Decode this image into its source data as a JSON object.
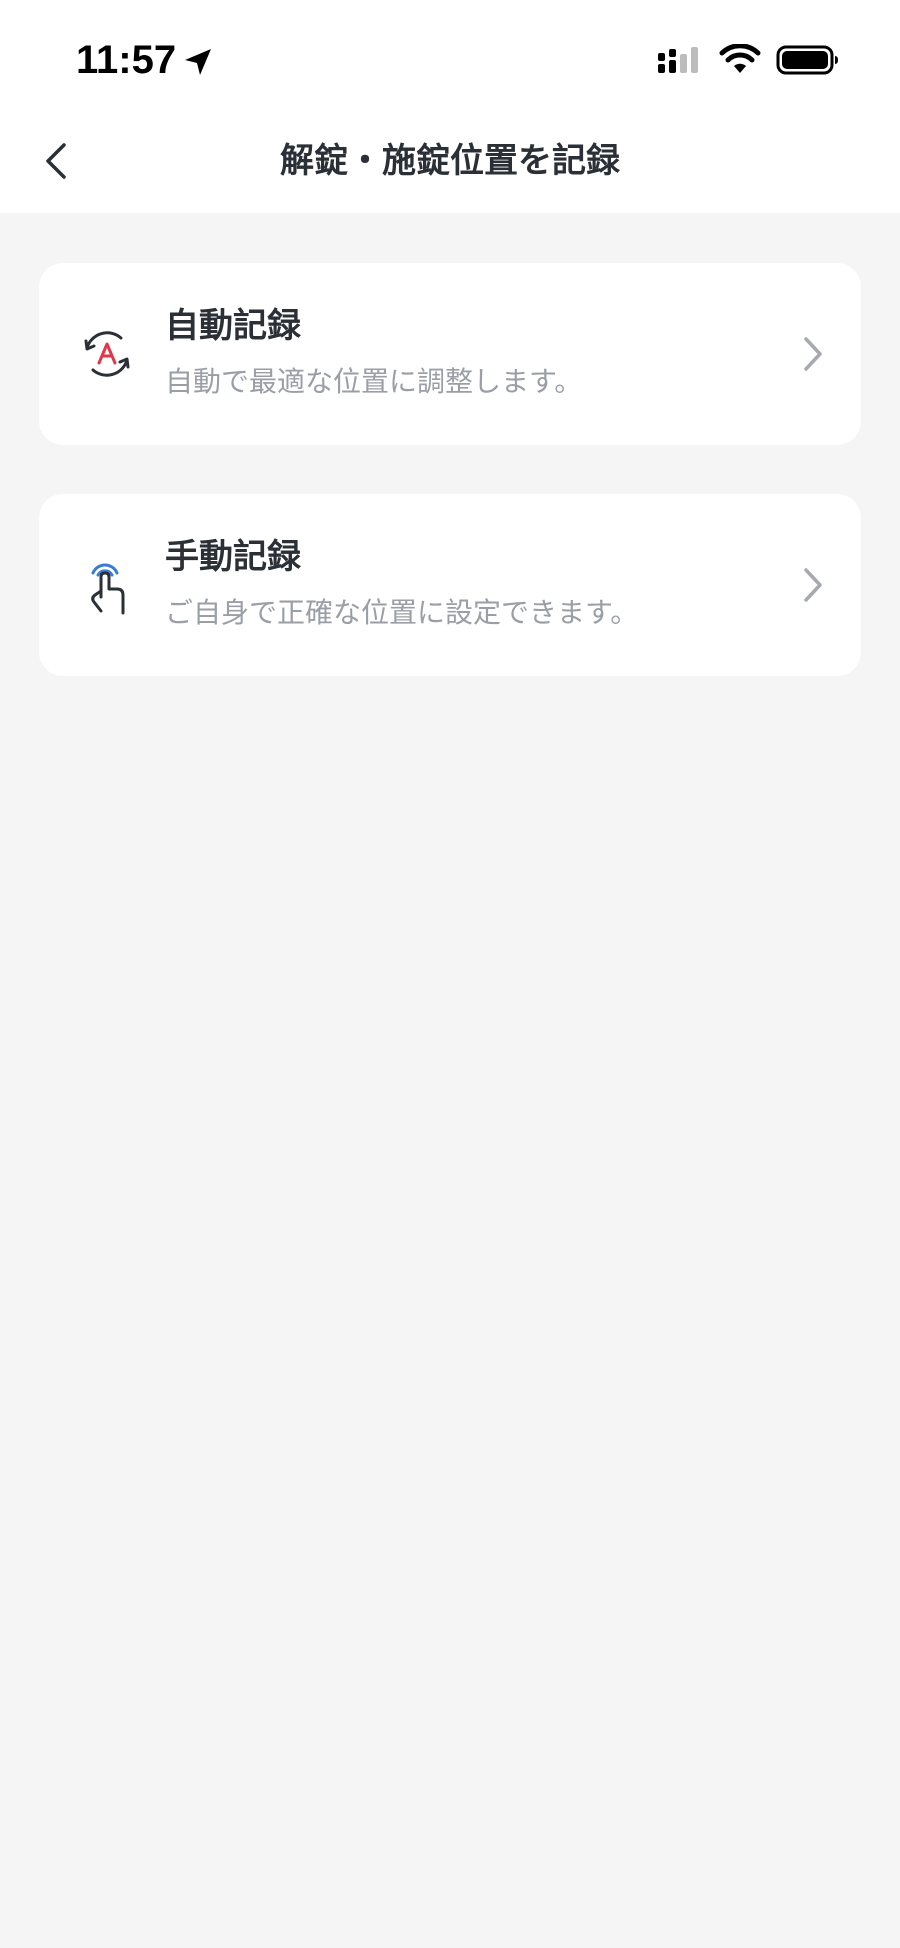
{
  "status_bar": {
    "time": "11:57"
  },
  "nav": {
    "title": "解錠・施錠位置を記録",
    "back_icon": "chevron-left-icon"
  },
  "options": [
    {
      "title": "自動記録",
      "subtitle": "自動で最適な位置に調整します。",
      "icon": "auto-rotate-icon"
    },
    {
      "title": "手動記録",
      "subtitle": "ご自身で正確な位置に設定できます。",
      "icon": "tap-hand-icon"
    }
  ],
  "colors": {
    "background": "#f5f5f5",
    "card": "#ffffff",
    "title_text": "#2b2f36",
    "subtitle_text": "#9a9ea6",
    "chevron": "#a6a9ae",
    "auto_icon_accent": "#e0384a",
    "manual_icon_accent": "#3a7bd5"
  }
}
